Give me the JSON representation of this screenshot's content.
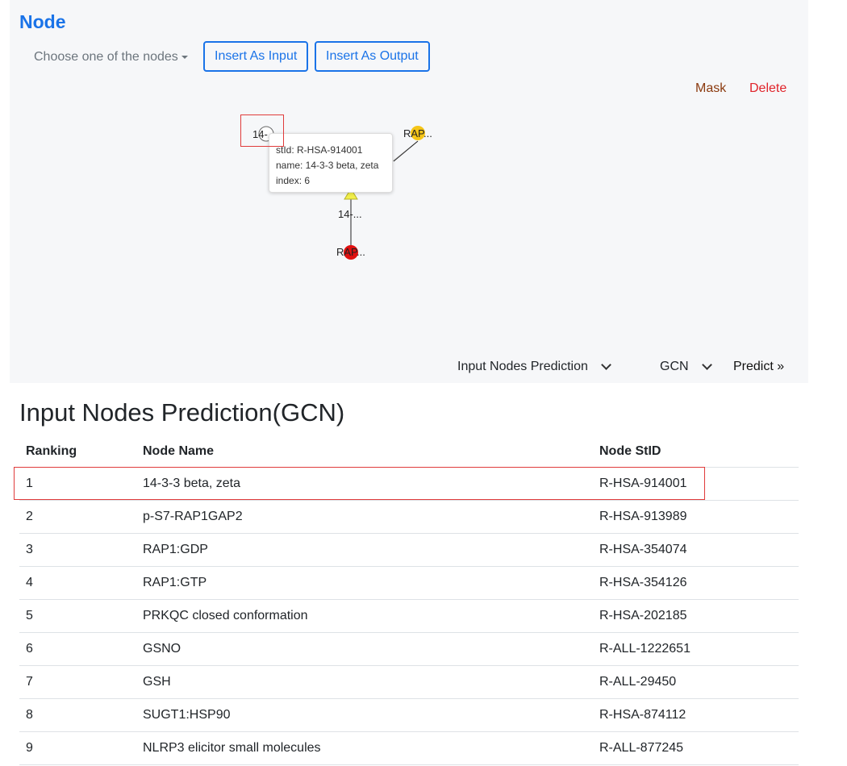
{
  "panel": {
    "title": "Node",
    "node_selector": {
      "placeholder": "Choose one of the nodes"
    },
    "insert_input_label": "Insert As Input",
    "insert_output_label": "Insert As Output",
    "mask_label": "Mask",
    "delete_label": "Delete"
  },
  "graph": {
    "nodes": [
      {
        "label": "14-..."
      },
      {
        "label": "RAP..."
      },
      {
        "label": "14-..."
      },
      {
        "label": "RAP..."
      }
    ],
    "tooltip": {
      "line1": "stId: R-HSA-914001",
      "line2": "name: 14-3-3 beta, zeta",
      "line3": "index: 6"
    }
  },
  "controls": {
    "prediction_type": "Input Nodes Prediction",
    "model": "GCN",
    "predict_label": "Predict »"
  },
  "results": {
    "heading": "Input Nodes Prediction(GCN)",
    "columns": [
      "Ranking",
      "Node Name",
      "Node StID"
    ],
    "rows": [
      {
        "rank": "1",
        "name": "14-3-3 beta, zeta",
        "stid": "R-HSA-914001"
      },
      {
        "rank": "2",
        "name": "p-S7-RAP1GAP2",
        "stid": "R-HSA-913989"
      },
      {
        "rank": "3",
        "name": "RAP1:GDP",
        "stid": "R-HSA-354074"
      },
      {
        "rank": "4",
        "name": "RAP1:GTP",
        "stid": "R-HSA-354126"
      },
      {
        "rank": "5",
        "name": "PRKQC closed conformation",
        "stid": "R-HSA-202185"
      },
      {
        "rank": "6",
        "name": "GSNO",
        "stid": "R-ALL-1222651"
      },
      {
        "rank": "7",
        "name": "GSH",
        "stid": "R-ALL-29450"
      },
      {
        "rank": "8",
        "name": "SUGT1:HSP90",
        "stid": "R-HSA-874112"
      },
      {
        "rank": "9",
        "name": "NLRP3 elicitor small molecules",
        "stid": "R-ALL-877245"
      }
    ]
  },
  "colors": {
    "accent": "#1a73e8",
    "mask": "#8b3a0f",
    "delete": "#e0242b",
    "node_yellow": "#f5c518",
    "node_red": "#e01010",
    "node_triangle": "#f2ef4a",
    "highlight": "#e03b3b"
  }
}
